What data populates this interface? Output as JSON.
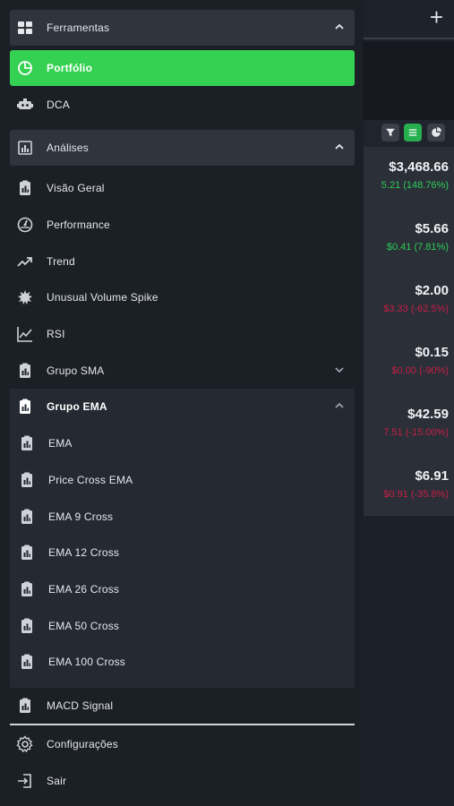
{
  "background": {
    "add_icon": "plus-icon",
    "filter_buttons": [
      "filter-icon",
      "list-icon",
      "pie-icon"
    ],
    "rows": [
      {
        "price": "$3,468.66",
        "change": "5.21 (148.76%)",
        "trend": "up"
      },
      {
        "price": "$5.66",
        "change": "$0.41 (7.81%)",
        "trend": "up"
      },
      {
        "price": "$2.00",
        "change": "$3.33 (-62.5%)",
        "trend": "down"
      },
      {
        "price": "$0.15",
        "change": "$0.00 (-90%)",
        "trend": "down"
      },
      {
        "price": "$42.59",
        "change": "7.51 (-15.00%)",
        "trend": "down"
      },
      {
        "price": "$6.91",
        "change": "$0.91 (-35.8%)",
        "trend": "down"
      }
    ]
  },
  "drawer": {
    "ferramentas": {
      "label": "Ferramentas",
      "expanded": true
    },
    "portfolio": {
      "label": "Portfólio",
      "active": true
    },
    "dca": {
      "label": "DCA"
    },
    "analises": {
      "label": "Análises",
      "expanded": true
    },
    "items": {
      "visao_geral": "Visão Geral",
      "performance": "Performance",
      "trend": "Trend",
      "unusual_volume": "Unusual Volume Spike",
      "rsi": "RSI",
      "grupo_sma": "Grupo SMA"
    },
    "grupo_ema": {
      "label": "Grupo EMA",
      "expanded": true,
      "items": [
        "EMA",
        "Price Cross EMA",
        "EMA 9 Cross",
        "EMA 12 Cross",
        "EMA 26 Cross",
        "EMA 50 Cross",
        "EMA 100 Cross"
      ]
    },
    "macd": "MACD Signal",
    "configuracoes": "Configurações",
    "sair": "Sair"
  },
  "colors": {
    "accent_green": "#35d152",
    "positive": "#2ecc55",
    "negative": "#c81f45",
    "drawer_bg": "#1b1f26"
  }
}
